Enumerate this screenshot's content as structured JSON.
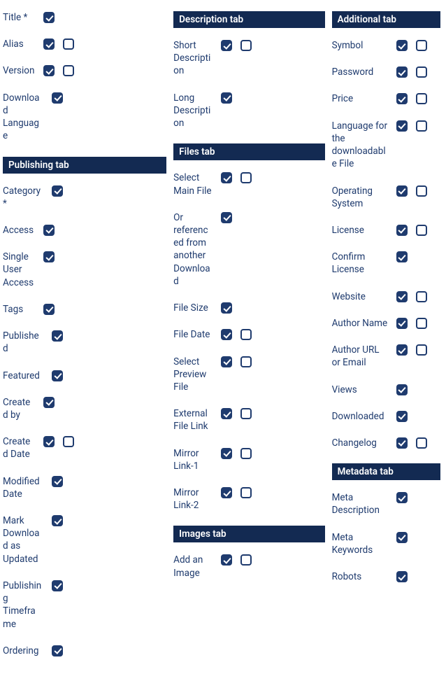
{
  "columns": [
    {
      "groups": [
        {
          "header": null,
          "rows": [
            {
              "label": "Title *",
              "c1": true,
              "c2": null
            },
            {
              "label": "Alias",
              "c1": true,
              "c2": false
            },
            {
              "label": "Version",
              "c1": true,
              "c2": false
            },
            {
              "label": "Download Language",
              "c1": true,
              "c2": null,
              "wide": true
            }
          ]
        },
        {
          "header": "Publishing tab",
          "rows": [
            {
              "label": "Category *",
              "c1": true,
              "c2": null,
              "wide": true
            },
            {
              "label": "Access",
              "c1": true,
              "c2": null
            },
            {
              "label": "Single User Access",
              "c1": true,
              "c2": null
            },
            {
              "label": "Tags",
              "c1": true,
              "c2": null
            },
            {
              "label": "Published",
              "c1": true,
              "c2": null,
              "wide": true
            },
            {
              "label": "Featured",
              "c1": true,
              "c2": null,
              "wide": true
            },
            {
              "label": "Created by",
              "c1": true,
              "c2": null
            },
            {
              "label": "Created Date",
              "c1": true,
              "c2": false
            },
            {
              "label": "Modified Date",
              "c1": true,
              "c2": null,
              "wide": true
            },
            {
              "label": "Mark Download as Updated",
              "c1": true,
              "c2": null,
              "wide": true
            },
            {
              "label": "Publishing Timeframe",
              "c1": true,
              "c2": null,
              "wide": true
            },
            {
              "label": "Ordering",
              "c1": true,
              "c2": null,
              "wide": true
            }
          ]
        }
      ]
    },
    {
      "groups": [
        {
          "header": "Description tab",
          "rows": [
            {
              "label": "Short Description",
              "c1": true,
              "c2": false,
              "wide": true
            },
            {
              "label": "Long Description",
              "c1": true,
              "c2": null,
              "wide": true
            }
          ]
        },
        {
          "header": "Files tab",
          "rows": [
            {
              "label": "Select Main File",
              "c1": true,
              "c2": false
            },
            {
              "label": "Or referenced from another Download",
              "c1": true,
              "c2": null,
              "wide": true
            },
            {
              "label": "File Size",
              "c1": true,
              "c2": null
            },
            {
              "label": "File Date",
              "c1": true,
              "c2": false
            },
            {
              "label": "Select Preview File",
              "c1": true,
              "c2": false
            },
            {
              "label": "External File Link",
              "c1": true,
              "c2": false
            },
            {
              "label": "Mirror Link-1",
              "c1": true,
              "c2": false
            },
            {
              "label": "Mirror Link-2",
              "c1": true,
              "c2": false
            }
          ]
        },
        {
          "header": "Images tab",
          "rows": [
            {
              "label": "Add an Image",
              "c1": true,
              "c2": false
            }
          ]
        }
      ]
    },
    {
      "groups": [
        {
          "header": "Additional tab",
          "rows": [
            {
              "label": "Symbol",
              "c1": true,
              "c2": false
            },
            {
              "label": "Password",
              "c1": true,
              "c2": false
            },
            {
              "label": "Price",
              "c1": true,
              "c2": false
            },
            {
              "label": "Language for the downloadable File",
              "c1": true,
              "c2": false
            },
            {
              "label": "Operating System",
              "c1": true,
              "c2": false
            },
            {
              "label": "License",
              "c1": true,
              "c2": false
            },
            {
              "label": "Confirm License",
              "c1": true,
              "c2": null
            },
            {
              "label": "Website",
              "c1": true,
              "c2": false
            },
            {
              "label": "Author Name",
              "c1": true,
              "c2": false
            },
            {
              "label": "Author URL or Email",
              "c1": true,
              "c2": false
            },
            {
              "label": "Views",
              "c1": true,
              "c2": null
            },
            {
              "label": "Downloaded",
              "c1": true,
              "c2": null
            },
            {
              "label": "Changelog",
              "c1": true,
              "c2": false
            }
          ]
        },
        {
          "header": "Metadata tab",
          "rows": [
            {
              "label": "Meta Description",
              "c1": true,
              "c2": null
            },
            {
              "label": "Meta Keywords",
              "c1": true,
              "c2": null
            },
            {
              "label": "Robots",
              "c1": true,
              "c2": null
            }
          ]
        }
      ]
    }
  ]
}
